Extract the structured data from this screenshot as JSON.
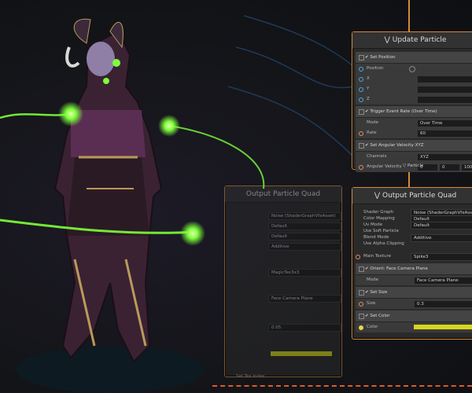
{
  "update_panel": {
    "title": "Update Particle",
    "set_position": "Set Position",
    "position_label": "Position",
    "x": "X",
    "y": "Y",
    "z": "Z",
    "trigger": "Trigger Event Rate (Over Time)",
    "mode_label": "Mode",
    "mode_value": "Over Time",
    "rate_label": "Rate",
    "rate_value": "60",
    "angular_title": "Set Angular Velocity XYZ",
    "channels_label": "Channels",
    "channels_value": "XYZ",
    "angular_label": "Angular Velocity",
    "angular_values": [
      "0",
      "0",
      "100"
    ],
    "footer": "Particle"
  },
  "output_panel": {
    "title": "Output Particle Quad",
    "shader_graph_label": "Shader Graph",
    "shader_graph_value": "Noise (ShaderGraphVfxAsset)",
    "color_mapping_label": "Color Mapping",
    "color_mapping_value": "Default",
    "uv_mode_label": "Uv Mode",
    "uv_mode_value": "Default",
    "soft_particle_label": "Use Soft Particle",
    "blend_mode_label": "Blend Mode",
    "blend_mode_value": "Additive",
    "alpha_clip_label": "Use Alpha Clipping",
    "main_texture_label": "Main Texture",
    "main_texture_value": "Spike3",
    "orient_title": "Orient: Face Camera Plane",
    "orient_mode_label": "Mode",
    "orient_mode_value": "Face Camera Plane",
    "size_title": "Set Size",
    "size_label": "Size",
    "size_value": "0.3",
    "color_title": "Set Color",
    "color_label": "Color"
  },
  "left_panel": {
    "title": "Output Particle Quad",
    "shader_value": "Noise (ShaderGraphVfxAsset)",
    "values": [
      "Default",
      "Default",
      "Additive"
    ],
    "texture_value": "MagicTex3x3",
    "orient_value": "Face Camera Plane",
    "number_value": "0.05",
    "tile_label": "Set Tex Index"
  },
  "colors": {
    "accent": "#d58a3a",
    "glow": "#7dff3a",
    "color_bar": "#d6d61e"
  }
}
